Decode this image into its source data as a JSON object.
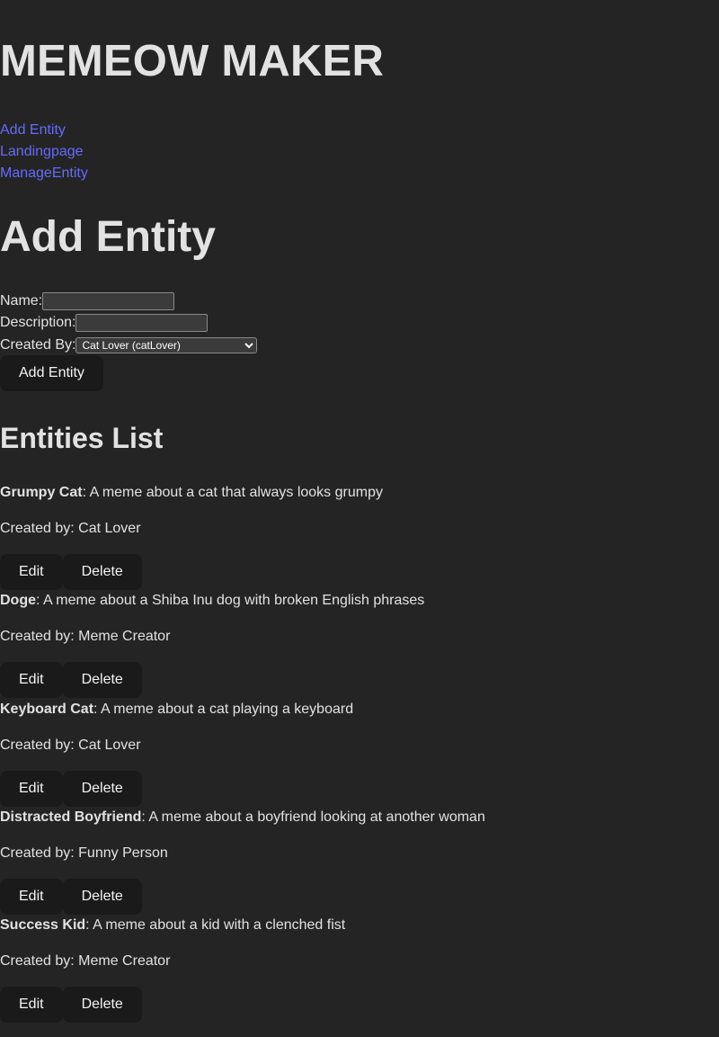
{
  "app": {
    "title": "MEMEOW MAKER"
  },
  "nav": {
    "items": [
      {
        "label": "Add Entity"
      },
      {
        "label": "Landingpage"
      },
      {
        "label": "ManageEntity"
      }
    ]
  },
  "page": {
    "title": "Add Entity"
  },
  "form": {
    "name_label": "Name:",
    "name_value": "",
    "description_label": "Description:",
    "description_value": "",
    "created_by_label": "Created By:",
    "created_by_selected": "Cat Lover (catLover)",
    "submit_label": "Add Entity"
  },
  "list": {
    "title": "Entities List",
    "created_by_prefix": "Created by: ",
    "edit_label": "Edit",
    "delete_label": "Delete",
    "entities": [
      {
        "name": "Grumpy Cat",
        "description": ": A meme about a cat that always looks grumpy",
        "creator": "Cat Lover"
      },
      {
        "name": "Doge",
        "description": ": A meme about a Shiba Inu dog with broken English phrases",
        "creator": "Meme Creator"
      },
      {
        "name": "Keyboard Cat",
        "description": ": A meme about a cat playing a keyboard",
        "creator": "Cat Lover"
      },
      {
        "name": "Distracted Boyfriend",
        "description": ": A meme about a boyfriend looking at another woman",
        "creator": "Funny Person"
      },
      {
        "name": "Success Kid",
        "description": ": A meme about a kid with a clenched fist",
        "creator": "Meme Creator"
      }
    ]
  },
  "colors": {
    "background": "#242424",
    "link": "#646cff",
    "button": "#1a1a1a"
  }
}
